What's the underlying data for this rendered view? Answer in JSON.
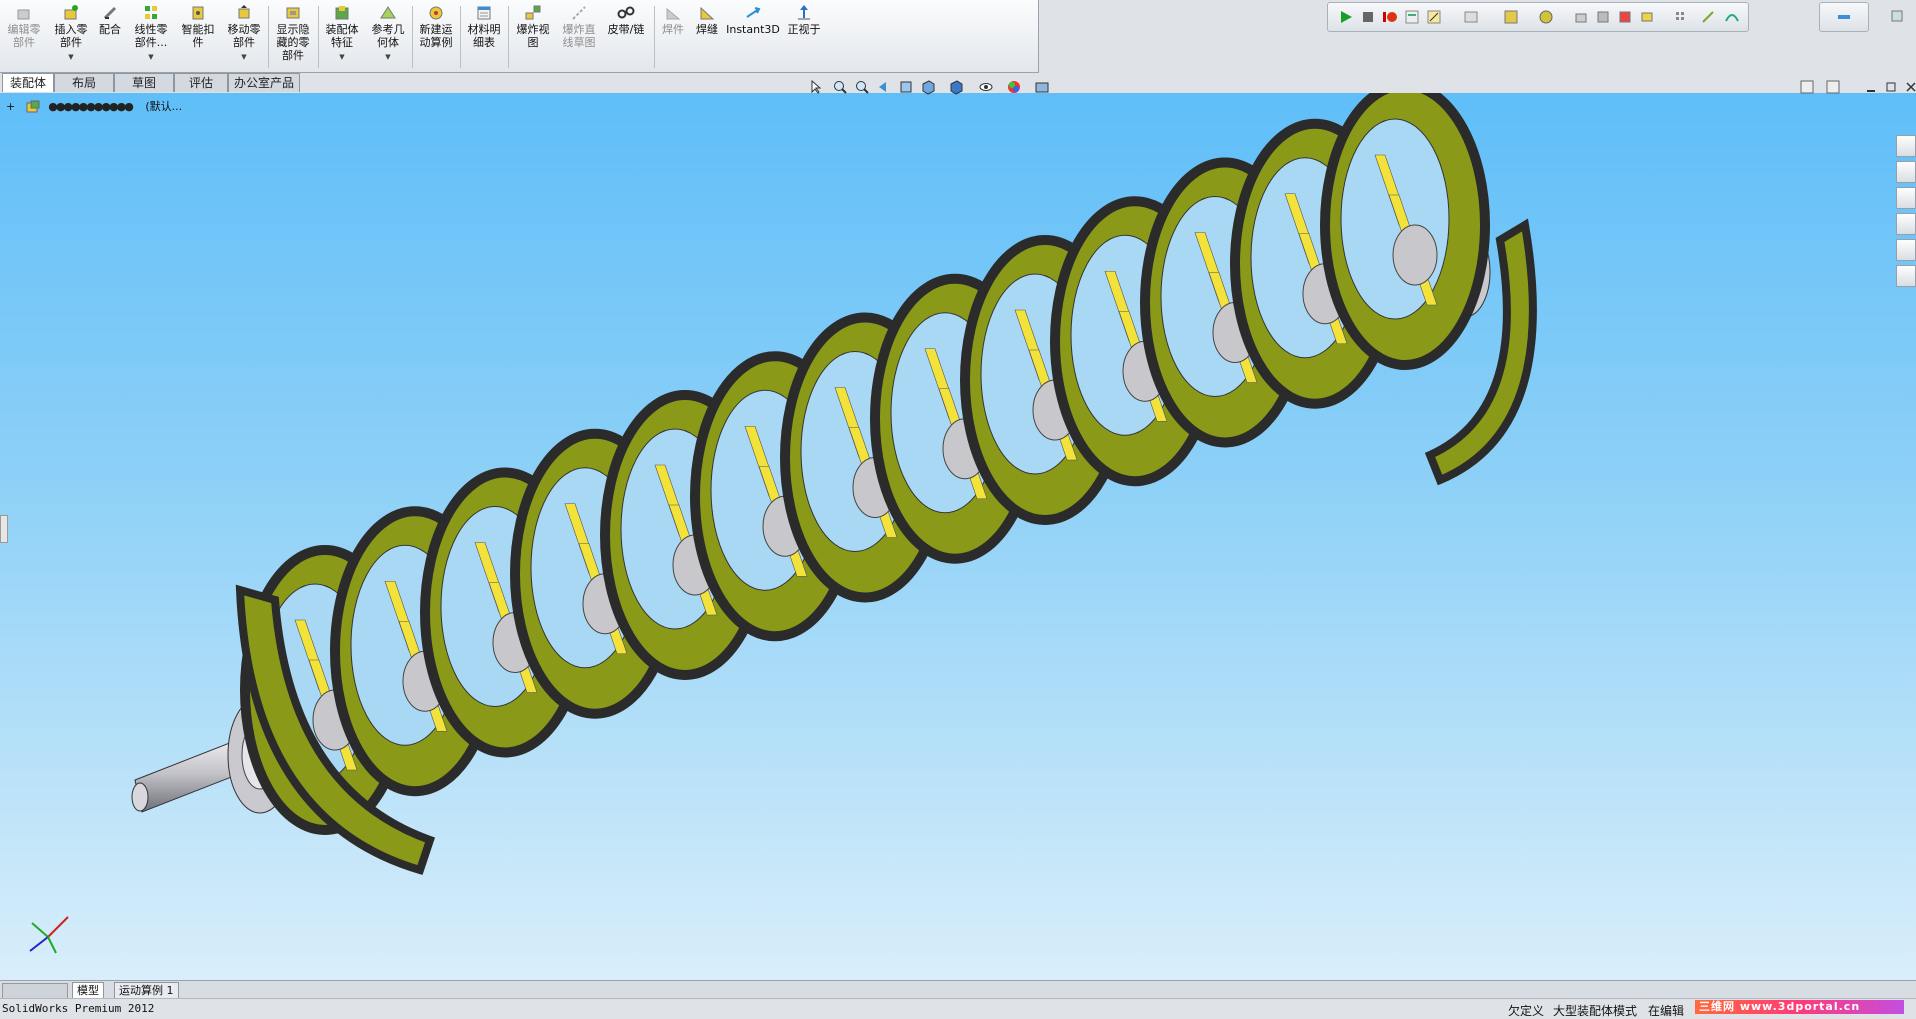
{
  "toolbar": {
    "buttons": [
      {
        "label1": "编辑零",
        "label2": "部件",
        "disabled": true
      },
      {
        "label1": "插入零",
        "label2": "部件",
        "dropdown": true
      },
      {
        "label1": "配合",
        "label2": ""
      },
      {
        "label1": "线性零",
        "label2": "部件...",
        "dropdown": true
      },
      {
        "label1": "智能扣",
        "label2": "件"
      },
      {
        "label1": "移动零",
        "label2": "部件",
        "dropdown": true
      },
      {
        "label1": "显示隐",
        "label2": "藏的零",
        "label3": "部件"
      },
      {
        "label1": "装配体",
        "label2": "特征",
        "dropdown": true
      },
      {
        "label1": "参考几",
        "label2": "何体",
        "dropdown": true
      },
      {
        "label1": "新建运",
        "label2": "动算例"
      },
      {
        "label1": "材料明",
        "label2": "细表"
      },
      {
        "label1": "爆炸视",
        "label2": "图"
      },
      {
        "label1": "爆炸直",
        "label2": "线草图",
        "disabled": true
      },
      {
        "label1": "皮带/链",
        "label2": ""
      },
      {
        "label1": "焊件",
        "label2": "",
        "disabled": true
      },
      {
        "label1": "焊缝",
        "label2": ""
      },
      {
        "label1": "Instant3D",
        "label2": ""
      },
      {
        "label1": "正视于",
        "label2": ""
      }
    ]
  },
  "tabs": [
    {
      "label": "装配体",
      "active": true
    },
    {
      "label": "布局"
    },
    {
      "label": "草图"
    },
    {
      "label": "评估"
    },
    {
      "label": "办公室产品"
    }
  ],
  "tree": {
    "expander": "+",
    "name_hidden": "●●●●●●●●●●●",
    "config": "(默认..."
  },
  "bottom_tabs": [
    {
      "label": "模型",
      "active": true
    },
    {
      "label": "运动算例 1"
    }
  ],
  "status": {
    "app": "SolidWorks Premium 2012",
    "state": "欠定义",
    "mode": "大型装配体模式",
    "editing": "在编辑",
    "watermark": "三维网 www.3dportal.cn"
  },
  "colors": {
    "flight_face": "#8a9a18",
    "flight_edge": "#2b2b2b",
    "bracket": "#f2e23a",
    "shaft": "#c8c8cc",
    "viewport_top": "#5fbef8",
    "viewport_bottom": "#d9eefa"
  },
  "icons": [
    "select-icon",
    "zoom-fit-icon",
    "zoom-area-icon",
    "previous-view-icon",
    "section-view-icon",
    "view-orientation-icon",
    "display-style-icon",
    "hide-show-icon",
    "appearance-icon",
    "scene-icon",
    "rebuild-icon",
    "options-icon"
  ]
}
